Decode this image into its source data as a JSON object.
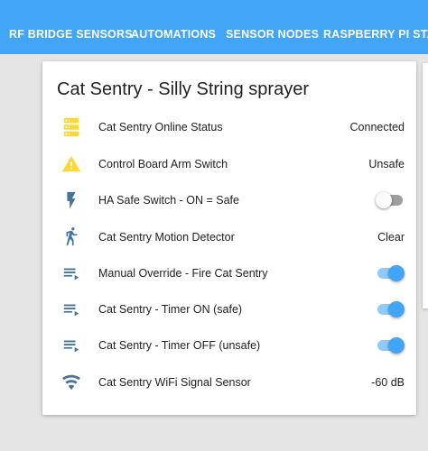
{
  "header": {
    "tabs": [
      {
        "label": "RF BRIDGE SENSORS"
      },
      {
        "label": "AUTOMATIONS"
      },
      {
        "label": "SENSOR NODES"
      },
      {
        "label": "RASPBERRY PI STATS"
      }
    ]
  },
  "card": {
    "title": "Cat Sentry - Silly String sprayer",
    "rows": [
      {
        "icon": "server-icon",
        "label": "Cat Sentry Online Status",
        "state": "Connected"
      },
      {
        "icon": "warning-icon",
        "label": "Control Board Arm Switch",
        "state": "Unsafe"
      },
      {
        "icon": "flash-icon",
        "label": "HA Safe Switch - ON = Safe",
        "toggle": false
      },
      {
        "icon": "walk-icon",
        "label": "Cat Sentry Motion Detector",
        "state": "Clear"
      },
      {
        "icon": "playlist-icon",
        "label": "Manual Override - Fire Cat Sentry",
        "toggle": true
      },
      {
        "icon": "playlist-icon",
        "label": "Cat Sentry - Timer ON (safe)",
        "toggle": true
      },
      {
        "icon": "playlist-icon",
        "label": "Cat Sentry - Timer OFF (unsafe)",
        "toggle": true
      },
      {
        "icon": "wifi-icon",
        "label": "Cat Sentry WiFi Signal Sensor",
        "state": "-60 dB"
      }
    ]
  },
  "colors": {
    "header": "#42a5f5",
    "icon_state_on": "#fdd835",
    "icon_default": "#44739e",
    "toggle_on": "#42a5f5"
  }
}
